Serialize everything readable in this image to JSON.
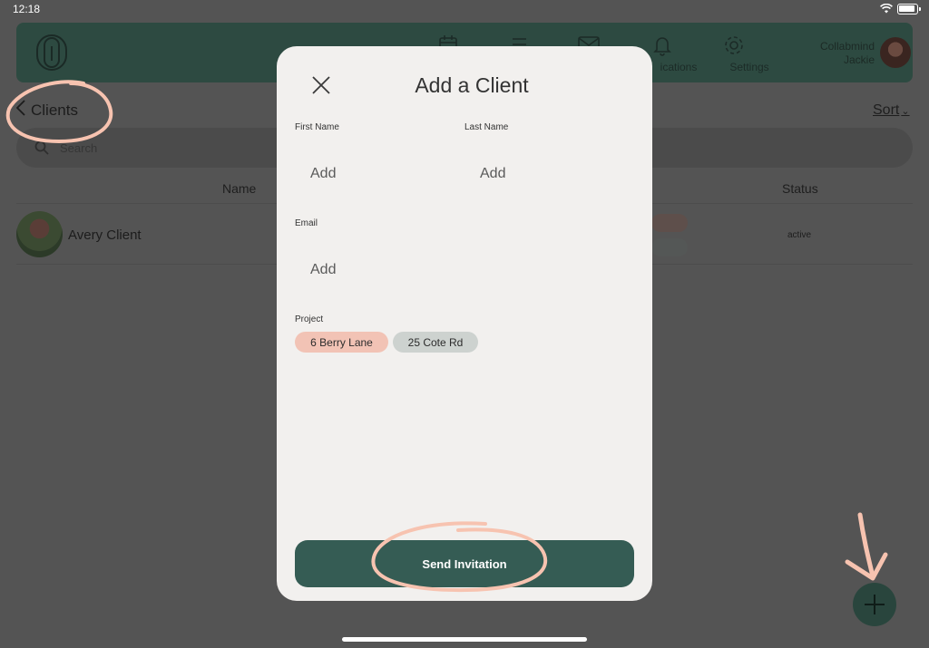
{
  "status_bar": {
    "time": "12:18"
  },
  "nav": {
    "items": [
      {
        "icon": "calendar-icon",
        "label": ""
      },
      {
        "icon": "list-icon",
        "label": ""
      },
      {
        "icon": "mail-icon",
        "label": ""
      },
      {
        "icon": "bell-icon",
        "label": "ications"
      },
      {
        "icon": "gear-icon",
        "label": "Settings"
      }
    ],
    "user": {
      "line1": "Collabmind",
      "line2": "Jackie"
    }
  },
  "page": {
    "back_label": "Clients",
    "sort_label": "Sort",
    "search_placeholder": "Search",
    "columns": {
      "name": "Name",
      "status": "Status"
    },
    "rows": [
      {
        "name": "Avery Client",
        "status": "active"
      }
    ]
  },
  "modal": {
    "title": "Add a Client",
    "first_name": {
      "label": "First Name",
      "placeholder": "Add"
    },
    "last_name": {
      "label": "Last Name",
      "placeholder": "Add"
    },
    "email": {
      "label": "Email",
      "placeholder": "Add"
    },
    "project": {
      "label": "Project",
      "chips": [
        {
          "label": "6 Berry Lane",
          "color": "#f2c3b5"
        },
        {
          "label": "25 Cote Rd",
          "color": "#cdd2cf"
        }
      ]
    },
    "send_label": "Send Invitation"
  },
  "colors": {
    "accent": "#355c54",
    "annotation": "#f7c3b0",
    "nav_bg": "#2d4a41"
  }
}
